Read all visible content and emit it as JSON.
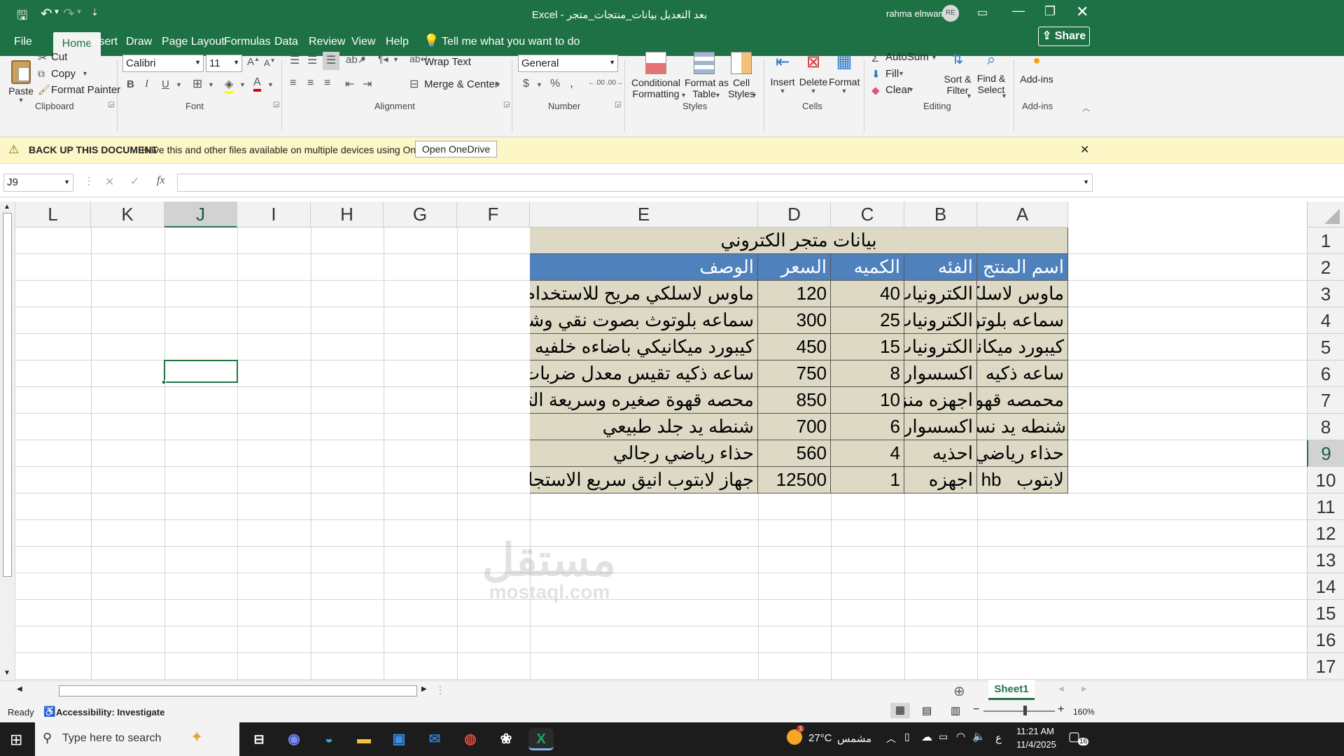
{
  "titlebar": {
    "title": "بعد التعديل بيانات_منتجات_متجر  -  Excel",
    "user": "rahma elnwam",
    "initials": "RE"
  },
  "menu": {
    "file": "File",
    "tabs": [
      "Home",
      "Insert",
      "Draw",
      "Page Layout",
      "Formulas",
      "Data",
      "Review",
      "View",
      "Help"
    ],
    "tell": "Tell me what you want to do",
    "share": "Share"
  },
  "ribbon": {
    "paste": "Paste",
    "cut": "Cut",
    "copy": "Copy",
    "format_painter": "Format Painter",
    "font_name": "Calibri",
    "font_size": "11",
    "wrap_text": "Wrap Text",
    "merge_center": "Merge & Center",
    "number_format": "General",
    "conditional_formatting": [
      "Conditional",
      "Formatting"
    ],
    "format_as_table": [
      "Format as",
      "Table"
    ],
    "cell_styles": [
      "Cell",
      "Styles"
    ],
    "insert": "Insert",
    "delete": "Delete",
    "format": "Format",
    "autosum": "AutoSum",
    "fill": "Fill",
    "clear": "Clear",
    "sort_filter": [
      "Sort &",
      "Filter"
    ],
    "find_select": [
      "Find &",
      "Select"
    ],
    "addins": "Add-ins",
    "groups": [
      "Clipboard",
      "Font",
      "Alignment",
      "Number",
      "Styles",
      "Cells",
      "Editing",
      "Add-ins"
    ]
  },
  "notification": {
    "bold": "BACK UP THIS DOCUMENT",
    "text": "Have this and other files available on multiple devices using OneDrive.",
    "button": "Open OneDrive"
  },
  "formula_bar": {
    "name_box": "J9",
    "fx": "fx",
    "value": ""
  },
  "sheet": {
    "columns_rtl": [
      "A",
      "B",
      "C",
      "D",
      "E",
      "F",
      "G",
      "H",
      "I",
      "J",
      "K",
      "L"
    ],
    "selected_column": "J",
    "selected_row": 9,
    "row_numbers": [
      "1",
      "2",
      "3",
      "4",
      "5",
      "6",
      "7",
      "8",
      "9",
      "10",
      "11",
      "12",
      "13",
      "14",
      "15",
      "16",
      "17"
    ],
    "title": "بيانات متجر الكتروني",
    "headers": [
      "اسم المنتج",
      "الفئه",
      "الكميه",
      "السعر",
      "الوصف"
    ],
    "rows": [
      [
        "ماوس لاسلكي",
        "الكترونيات",
        "40",
        "120",
        "ماوس لاسلكي مريح للاستخدام الطويل"
      ],
      [
        "سماعه بلوتوث",
        "الكترونيات",
        "25",
        "300",
        "سماعه بلوتوث بصوت نقي وشحن سريع"
      ],
      [
        "كيبورد ميكانيكي",
        "الكترونيات",
        "15",
        "450",
        "كيبورد ميكانيكي باضاءه خلفيه ملونه"
      ],
      [
        "ساعه ذكيه",
        "اكسسوارات",
        "8",
        "750",
        "ساعه ذكيه تقيس معدل ضربات القلب"
      ],
      [
        "محمصه قهوة",
        "اجهزه منزليه",
        "10",
        "850",
        "محصه قهوة صغيره وسريعة التسخين"
      ],
      [
        "شنطه يد نسائيه",
        "اكسسوارات",
        "6",
        "700",
        "شنطه يد جلد طبيعي"
      ],
      [
        "حذاء رياضي",
        "احذيه",
        "4",
        "560",
        "حذاء رياضي رجالي"
      ],
      [
        "لابتوب   hb",
        "اجهزه",
        "1",
        "12500",
        "جهاز لابتوب انيق سريع الاستجابه"
      ]
    ]
  },
  "sheet_tab": "Sheet1",
  "status": {
    "ready": "Ready",
    "accessibility": "Accessibility: Investigate",
    "zoom": "160%"
  },
  "taskbar": {
    "search_placeholder": "Type here to search",
    "weather_temp": "27°C",
    "weather_text": "مشمس",
    "weather_badge": "3",
    "lang": "ع",
    "time": "11:21 AM",
    "date": "11/4/2025",
    "notif_count": "16"
  },
  "watermark": {
    "arabic": "مستقل",
    "latin": "mostaql.com"
  },
  "colors": {
    "excel_green": "#1e7145",
    "table_header_blue": "#4f81bd",
    "table_body_tan": "#ddd9c4",
    "notification_yellow": "#fdf6c7"
  }
}
